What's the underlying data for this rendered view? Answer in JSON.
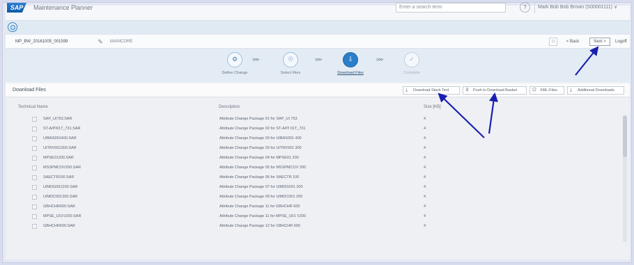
{
  "shell": {
    "logo_text": "SAP",
    "app_title": "Maintenance Planner",
    "search_placeholder": "Enter a search term",
    "help_symbol": "?",
    "user_menu": "Mark Bob Bob Brown (S00001111) ∨"
  },
  "plan": {
    "name": "MP_BW_20161005_001599",
    "description": "MAINCORE"
  },
  "toolbar": {
    "save_symbol": "□",
    "back_label": "< Back",
    "next_label": "Next >",
    "logoff_label": "Logoff"
  },
  "roadmap": {
    "steps": [
      {
        "label": "Define Change",
        "symbol": "⚙"
      },
      {
        "label": "Select Files",
        "symbol": "☉"
      },
      {
        "label": "Download Files",
        "symbol": "⇩"
      },
      {
        "label": "Complete",
        "symbol": "✓"
      }
    ],
    "separator": ">>>"
  },
  "panel": {
    "title": "Download Files",
    "buttons": {
      "download": "Download Stack Text",
      "push": "Push to Download Basket",
      "xml": "XML-Files",
      "additional": "Additional Downloads"
    }
  },
  "table": {
    "headers": {
      "name": "Technical Name",
      "desc": "Description",
      "size": "Size [KB]"
    },
    "rows": [
      {
        "name": "SAP_UI753.SAR",
        "desc": "Attribute Change Package 01 for SAP_UI 753",
        "size": "4"
      },
      {
        "name": "ST-A/PI01T_731.SAR",
        "desc": "Attribute Change Package 02 for ST-A/PI 01T_731",
        "size": "4"
      },
      {
        "name": "UIBAS001400.SAR",
        "desc": "Attribute Change Package 03 for UIBAS001 400",
        "size": "4"
      },
      {
        "name": "UITRV001300.SAR",
        "desc": "Attribute Change Package 03 for UITRV001 300",
        "size": "4"
      },
      {
        "name": "MPSE01200.SAR",
        "desc": "Attribute Change Package 04 for MPSE01 200",
        "size": "4"
      },
      {
        "name": "MSSPMCOV200.SAR",
        "desc": "Attribute Change Package 05 for MSSPMCOV 200",
        "size": "4"
      },
      {
        "name": "SAECTR100.SAR",
        "desc": "Attribute Change Package 06 for SAECTR 100",
        "size": "4"
      },
      {
        "name": "UIMDG001200.SAR",
        "desc": "Attribute Change Package 07 for UIMDG001 200",
        "size": "4"
      },
      {
        "name": "UIMDC001200.SAR",
        "desc": "Attribute Change Package 09 for UIMDC001 200",
        "size": "4"
      },
      {
        "name": "GBHCHR600.SAR",
        "desc": "Attribute Change Package 11 for GBHCHR 600",
        "size": "4"
      },
      {
        "name": "MPSE_U01V200.SAR",
        "desc": "Attribute Change Package 11 for MPSE_U01 V200",
        "size": "4"
      },
      {
        "name": "GBHCHR600.SAR",
        "desc": "Attribute Change Package 12 for GBHCHR 600",
        "size": "4"
      }
    ]
  }
}
